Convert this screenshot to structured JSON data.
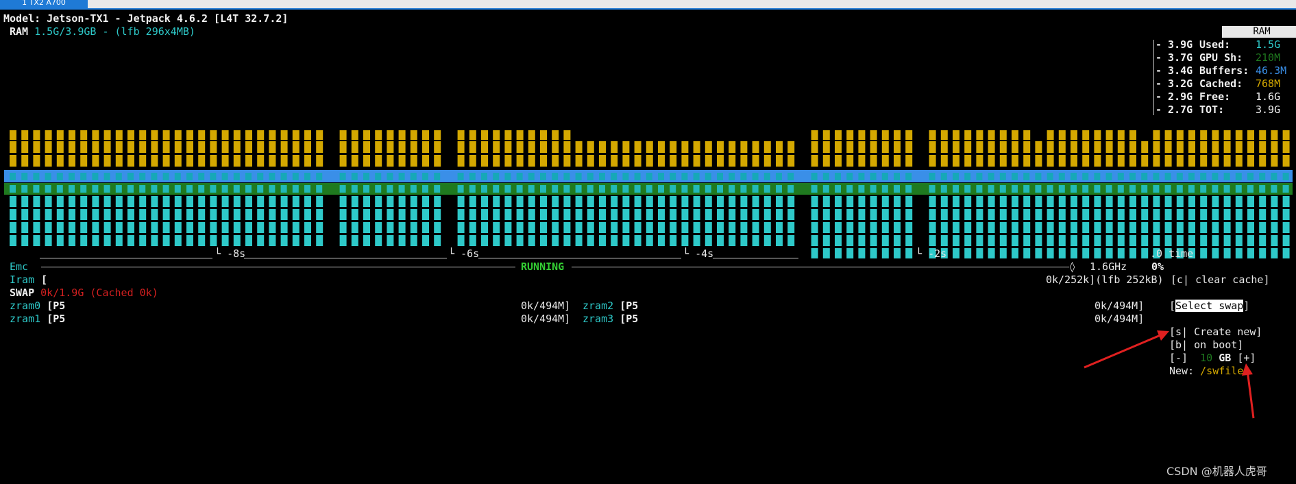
{
  "tab": {
    "label": "1 TX2 A700"
  },
  "header": {
    "model_line": "Model: Jetson-TX1 - Jetpack 4.6.2 [L4T 32.7.2]",
    "ram_label": "RAM",
    "ram_value": "1.5G/3.9GB - (lfb 296x4MB)"
  },
  "ram_legend": {
    "title": "RAM",
    "scale": [
      "3.9G",
      "3.7G",
      "3.4G",
      "3.2G",
      "2.9G",
      "2.7G"
    ],
    "items": [
      {
        "label": "Used:",
        "value": "1.5G",
        "color": "#2ec9c9"
      },
      {
        "label": "GPU Sh:",
        "value": "210M",
        "color": "#1f7a1f"
      },
      {
        "label": "Buffers:",
        "value": "46.3M",
        "color": "#3a8fe8"
      },
      {
        "label": "Cached:",
        "value": "768M",
        "color": "#d4a800"
      },
      {
        "label": "Free:",
        "value": "1.6G",
        "color": "#f0f0f0"
      },
      {
        "label": "TOT:",
        "value": "3.9G",
        "color": "#f0f0f0"
      }
    ]
  },
  "time_axis": {
    "labels": [
      "-8s",
      "-6s",
      "-4s",
      "-2s",
      "0 time"
    ]
  },
  "emc": {
    "label": "Emc",
    "status": "RUNNING",
    "freq": "1.6GHz",
    "percent": "0%"
  },
  "iram": {
    "label": "Iram",
    "open": "[",
    "value": "0k/252k](lfb 252kB)",
    "action": "[c| clear cache]"
  },
  "swap": {
    "label": "SWAP",
    "value": "0k/1.9G (Cached 0k)"
  },
  "zram": [
    {
      "name": "zram0",
      "bar": "[P5",
      "value": "0k/494M]"
    },
    {
      "name": "zram1",
      "bar": "[P5",
      "value": "0k/494M]"
    },
    {
      "name": "zram2",
      "bar": "[P5",
      "value": "0k/494M]"
    },
    {
      "name": "zram3",
      "bar": "[P5",
      "value": "0k/494M]"
    }
  ],
  "swap_menu": {
    "select": "Select swap",
    "create": "[s| Create new]",
    "boot": "[b| on boot]",
    "minus": "[-]",
    "size": "10",
    "unit": "GB",
    "plus": "[+]",
    "new_label": "New:",
    "new_path": "/swfile"
  },
  "watermark": "CSDN @机器人虎哥",
  "colors": {
    "used": "#2ec9c9",
    "buffers": "#3a8fe8",
    "gpu": "#1f7a1f",
    "cached": "#d4a800",
    "running": "#33cc33",
    "swap": "#d42020"
  }
}
